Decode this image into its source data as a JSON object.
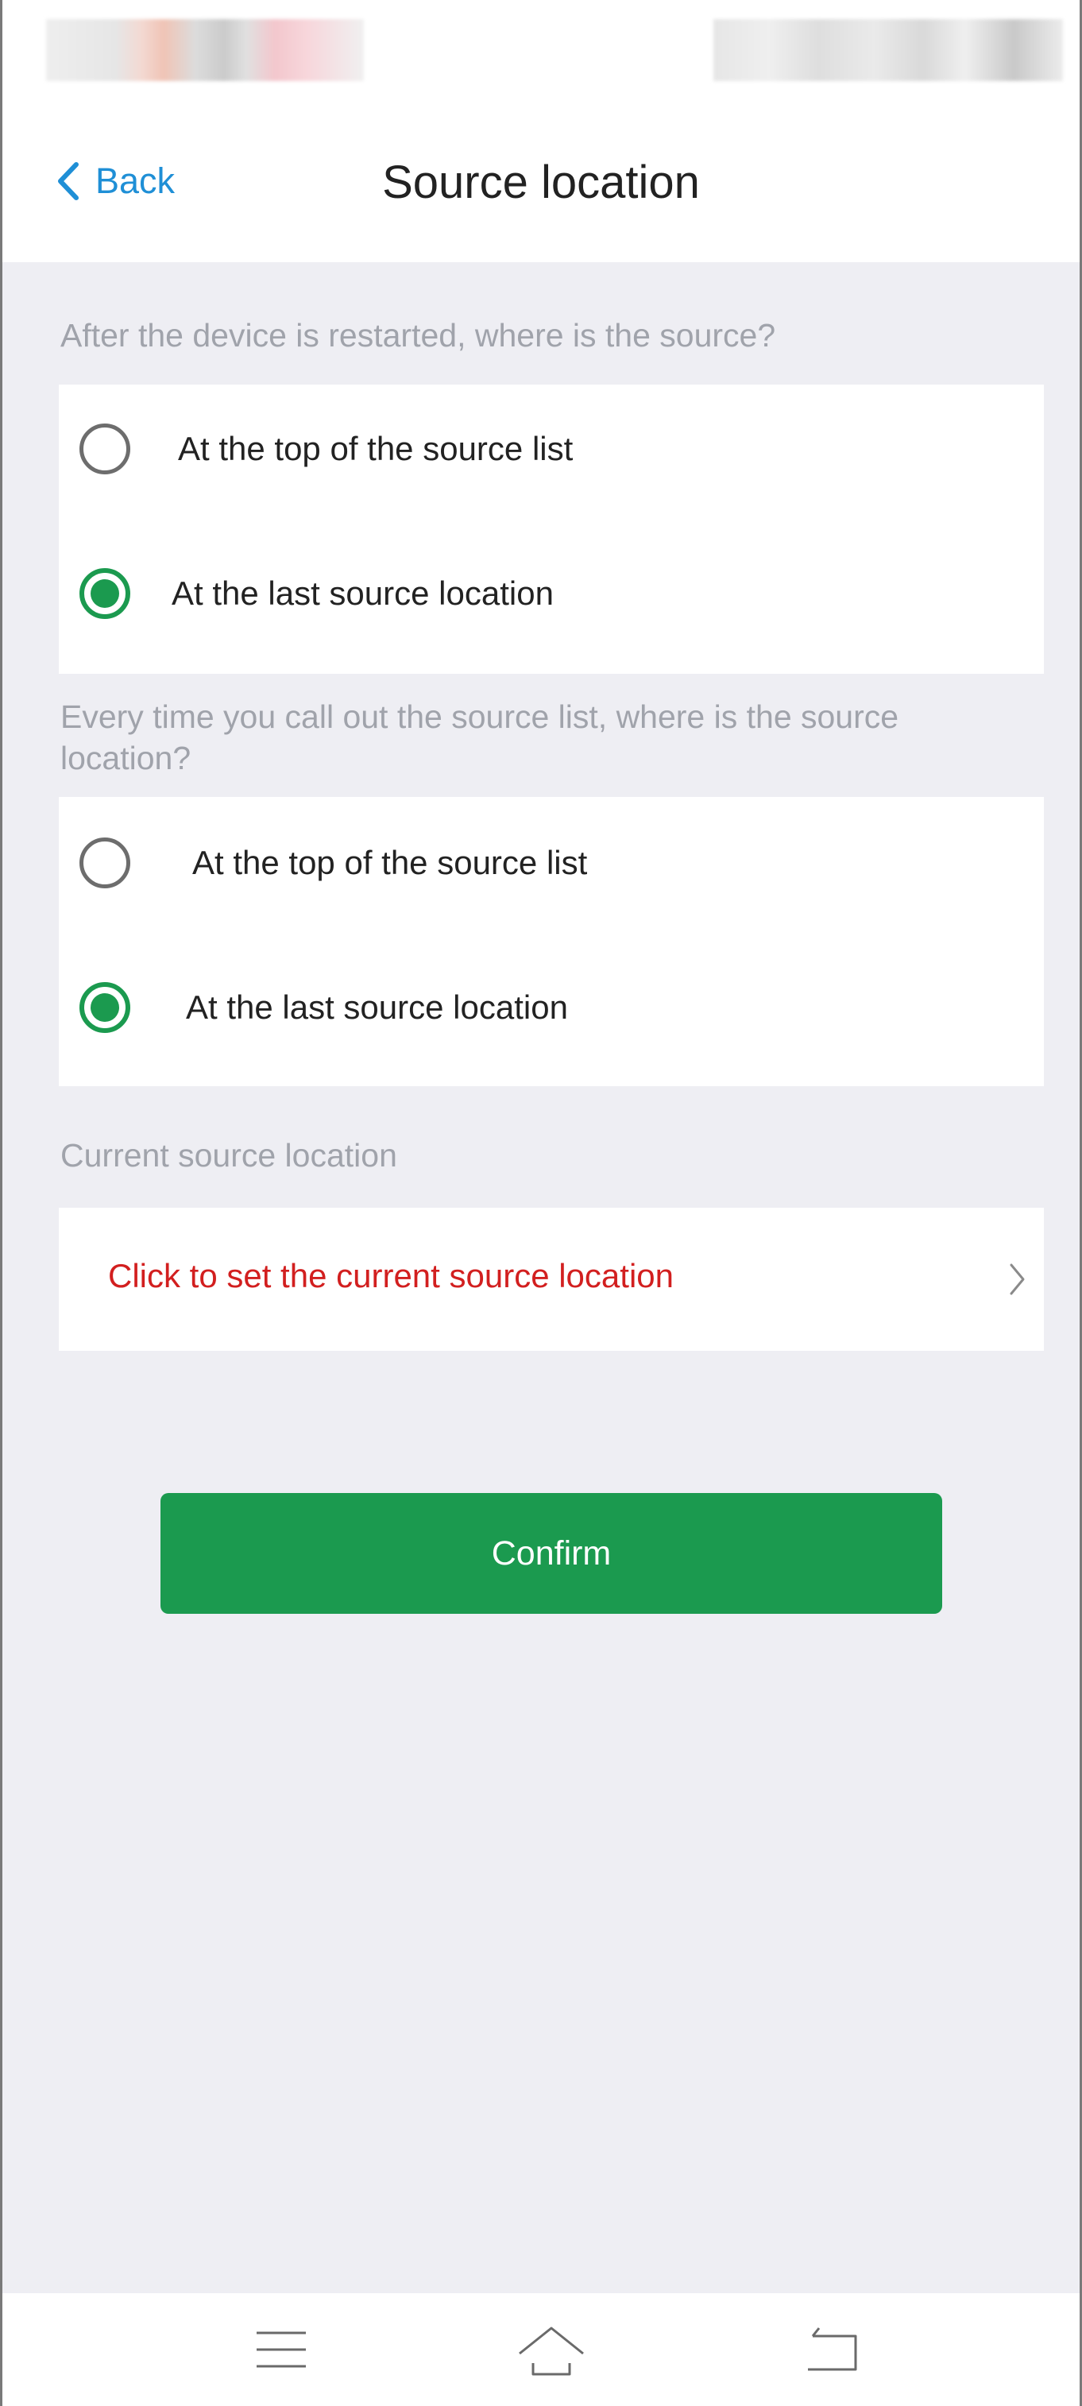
{
  "header": {
    "back_label": "Back",
    "title": "Source location"
  },
  "sections": [
    {
      "label": "After the device is restarted, where is the source?",
      "options": [
        {
          "label": "At the top of the source list",
          "selected": false
        },
        {
          "label": "At the last source location",
          "selected": true
        }
      ]
    },
    {
      "label": "Every time you call out the source list, where is the source location?",
      "options": [
        {
          "label": "At the top of the source list",
          "selected": false
        },
        {
          "label": "At the last source location",
          "selected": true
        }
      ]
    }
  ],
  "current_location": {
    "label": "Current source location",
    "link_text": "Click to set the current source location"
  },
  "confirm_label": "Confirm",
  "bottom_nav": {
    "icons": [
      "menu-icon",
      "home-icon",
      "back-nav-icon"
    ]
  },
  "colors": {
    "accent_green": "#1b9a4f",
    "link_red": "#d21f1f",
    "back_blue": "#1f8fd6",
    "background": "#eeeef3"
  }
}
